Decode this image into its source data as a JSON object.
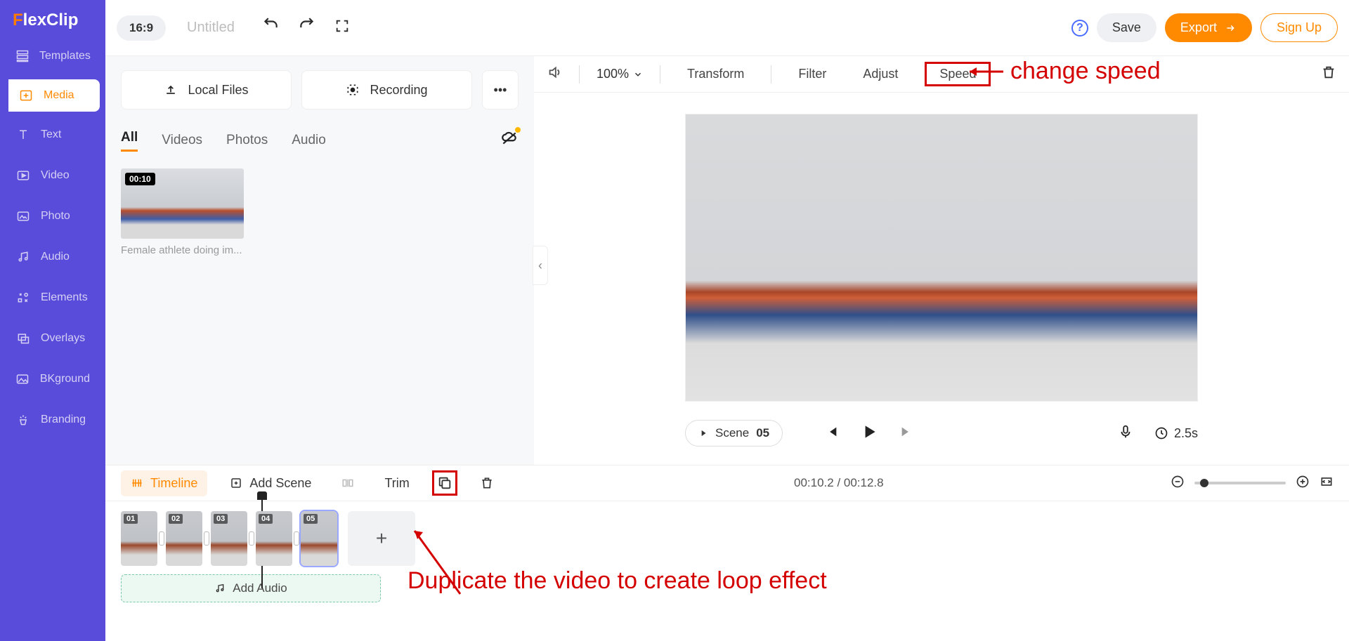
{
  "logo": "FlexClip",
  "sidebar": {
    "items": [
      {
        "label": "Templates"
      },
      {
        "label": "Media"
      },
      {
        "label": "Text"
      },
      {
        "label": "Video"
      },
      {
        "label": "Photo"
      },
      {
        "label": "Audio"
      },
      {
        "label": "Elements"
      },
      {
        "label": "Overlays"
      },
      {
        "label": "BKground"
      },
      {
        "label": "Branding"
      }
    ]
  },
  "topbar": {
    "ratio": "16:9",
    "title": "Untitled",
    "save": "Save",
    "export": "Export",
    "signup": "Sign Up"
  },
  "media": {
    "localfiles": "Local Files",
    "recording": "Recording",
    "tabs": [
      "All",
      "Videos",
      "Photos",
      "Audio"
    ],
    "thumb_duration": "00:10",
    "thumb_label": "Female athlete doing im..."
  },
  "preview_bar": {
    "zoom": "100%",
    "transform": "Transform",
    "filter": "Filter",
    "adjust": "Adjust",
    "speed": "Speed"
  },
  "annotations": {
    "speed": "change speed",
    "duplicate": "Duplicate the video to create loop effect"
  },
  "controls": {
    "scene_label": "Scene",
    "scene_num": "05",
    "duration": "2.5s"
  },
  "timeline": {
    "timeline_label": "Timeline",
    "addscene": "Add Scene",
    "trim": "Trim",
    "time": "00:10.2 / 00:12.8",
    "addaudio": "Add Audio",
    "scenes": [
      "01",
      "02",
      "03",
      "04",
      "05"
    ]
  }
}
